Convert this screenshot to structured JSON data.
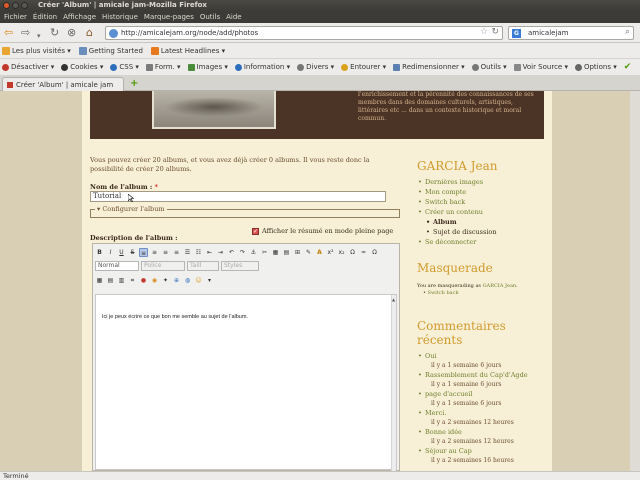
{
  "window": {
    "title": "Créer 'Album' | amicale jam-Mozilla Firefox"
  },
  "menu": [
    "Fichier",
    "Édition",
    "Affichage",
    "Historique",
    "Marque-pages",
    "Outils",
    "Aide"
  ],
  "nav": {
    "url": "http://amicalejam.org/node/add/photos",
    "search_value": "amicalejam",
    "search_engine": "G"
  },
  "bookmarks": [
    "Les plus visités ▾",
    "Getting Started",
    "Latest Headlines ▾"
  ],
  "devbar": [
    "Désactiver ▾",
    "Cookies ▾",
    "CSS ▾",
    "Form. ▾",
    "Images ▾",
    "Information ▾",
    "Divers ▾",
    "Entourer ▾",
    "Redimensionner ▾",
    "Outils ▾",
    "Voir Source ▾",
    "Options ▾"
  ],
  "tab": {
    "label": "Créer 'Album' | amicale jam"
  },
  "banner_text": "l'enrichissement et la pérennité des connaissances de ses membres dans des domaines culturels, artistiques, littéraires etc ... dans un contexte historique et moral commun.",
  "form": {
    "intro": "Vous pouvez créer 20 albums, et vous avez déjà créer 0 albums. Il vous reste donc la possibilité de créer 20 albums.",
    "album_label": "Nom de l'album :",
    "required_mark": "*",
    "album_value": "Tutorial",
    "fieldset_legend": "▾ Configurer l'album",
    "checkbox_label": "Afficher le résumé en mode pleine page",
    "checkbox_mark": "✓",
    "desc_label": "Description de l'album :"
  },
  "editor": {
    "format_select": "Normal",
    "font_select": "Police",
    "size_select": "Taill",
    "styles_select": "Styles",
    "text": "Ici je peux écrire ce que bon me semble au sujet de l'album.",
    "toolbar_row1": [
      "B",
      "I",
      "U",
      "S",
      "≡",
      "≡",
      "≡",
      "≡",
      "☰",
      "☷",
      "⇤",
      "⇥",
      "↶",
      "↷",
      "⚓",
      "✂",
      "▦",
      "▤",
      "⊞",
      "✎",
      "A",
      "x²",
      "x₂",
      "Ω",
      "≈",
      "Ω"
    ],
    "toolbar_row3": [
      "▦",
      "▤",
      "▥",
      "⌗",
      "●",
      "◉",
      "✦",
      "⊕",
      "◍",
      "☺",
      "▾"
    ]
  },
  "sidebar": {
    "user_title": "GARCIA Jean",
    "user_links": [
      {
        "label": "Dernières images",
        "sub": false,
        "bold": false
      },
      {
        "label": "Mon compte",
        "sub": false,
        "bold": false
      },
      {
        "label": "Switch back",
        "sub": false,
        "bold": false
      },
      {
        "label": "Créer un contenu",
        "sub": false,
        "bold": false
      },
      {
        "label": "Album",
        "sub": true,
        "bold": true
      },
      {
        "label": "Sujet de discussion",
        "sub": true,
        "bold": false
      },
      {
        "label": "Se déconnecter",
        "sub": false,
        "bold": false
      }
    ],
    "masquerade_title": "Masquerade",
    "masquerade_text": "You are masquerading as",
    "masquerade_user": "GARCIA Jean",
    "masquerade_switch": "Switch back",
    "comments_title_1": "Commentaires",
    "comments_title_2": "récents",
    "comments": [
      {
        "title": "Oui",
        "ago": "il y a 1 semaine 6 jours"
      },
      {
        "title": "Rassemblement du Cap'd'Agde",
        "ago": "il y a 1 semaine 6 jours"
      },
      {
        "title": "page d'accueil",
        "ago": "il y a 1 semaine 6 jours"
      },
      {
        "title": "Merci.",
        "ago": "il y a 2 semaines 12 heures"
      },
      {
        "title": "Bonne idée",
        "ago": "il y a 2 semaines 12 heures"
      },
      {
        "title": "Séjour au Cap",
        "ago": "il y a 2 semaines 16 heures"
      }
    ]
  },
  "status": {
    "text": "Terminé"
  }
}
